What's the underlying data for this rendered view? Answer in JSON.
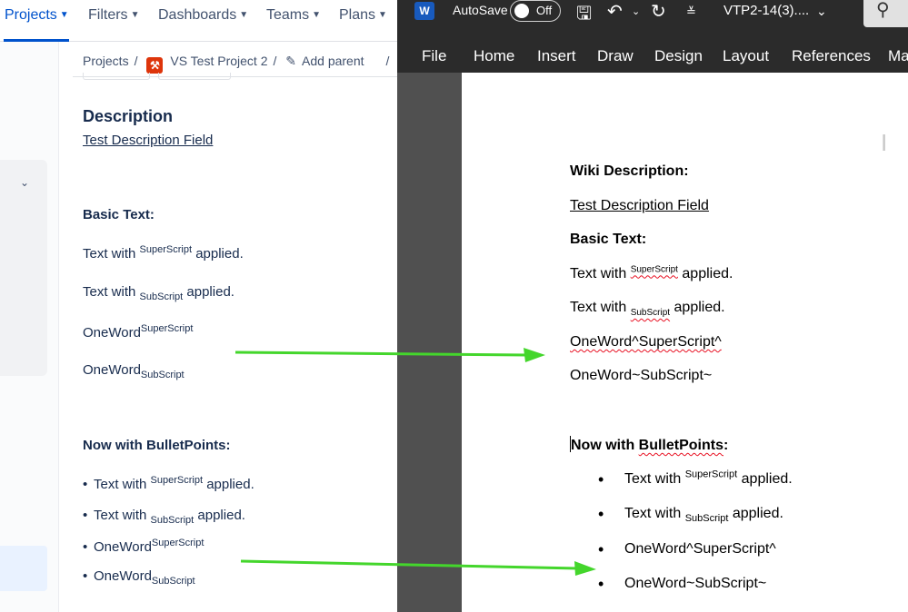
{
  "jira": {
    "nav": [
      {
        "label": "Projects"
      },
      {
        "label": "Filters"
      },
      {
        "label": "Dashboards"
      },
      {
        "label": "Teams"
      },
      {
        "label": "Plans"
      }
    ],
    "breadcrumb": {
      "projects": "Projects",
      "project": "VS Test Project 2",
      "add_parent": "Add parent",
      "sep": "/"
    },
    "description_heading": "Description",
    "description_link": "Test Description Field",
    "basic_heading": "Basic Text:",
    "text_with": "Text with",
    "superscript": "SuperScript",
    "subscript": "SubScript",
    "applied": "applied.",
    "oneword": "OneWord",
    "bullets_heading": "Now with BulletPoints:"
  },
  "word": {
    "autosave": "AutoSave",
    "toggle_state": "Off",
    "doc_name": "VTP2-14(3)....",
    "tabs": [
      "File",
      "Home",
      "Insert",
      "Draw",
      "Design",
      "Layout",
      "References",
      "Ma"
    ],
    "wiki_heading": "Wiki Description:",
    "desc_link": "Test Description Field",
    "basic_heading": "Basic Text:",
    "text_with": "Text with",
    "superscript": "SuperScript",
    "subscript": "SubScript",
    "applied": "applied.",
    "oneword_sup_raw": "OneWord^SuperScript^",
    "oneword_sub_raw": "OneWord~SubScript~",
    "bullets_heading_now": "Now with ",
    "bullets_heading_rest": "BulletPoints",
    "bullets_heading_colon": ":"
  },
  "colors": {
    "jira_blue": "#0052cc",
    "arrow_green": "#44d62c",
    "word_dark": "#2b2b2b",
    "spell_red": "#e81123"
  }
}
